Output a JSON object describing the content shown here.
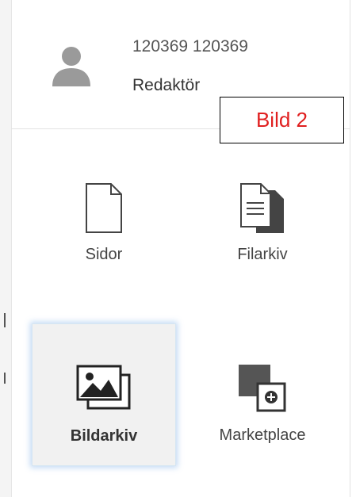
{
  "user": {
    "name": "120369 120369",
    "role": "Redaktör"
  },
  "annotation": {
    "label": "Bild 2",
    "color": "#e01f1f"
  },
  "tiles": [
    {
      "label": "Sidor",
      "icon": "page-icon",
      "active": false
    },
    {
      "label": "Filarkiv",
      "icon": "file-archive-icon",
      "active": false
    },
    {
      "label": "Bildarkiv",
      "icon": "image-archive-icon",
      "active": true
    },
    {
      "label": "Marketplace",
      "icon": "marketplace-icon",
      "active": false
    }
  ],
  "colors": {
    "active_tile_bg": "#f1f1f1",
    "active_glow": "#78aae6",
    "icon": "#444444"
  }
}
